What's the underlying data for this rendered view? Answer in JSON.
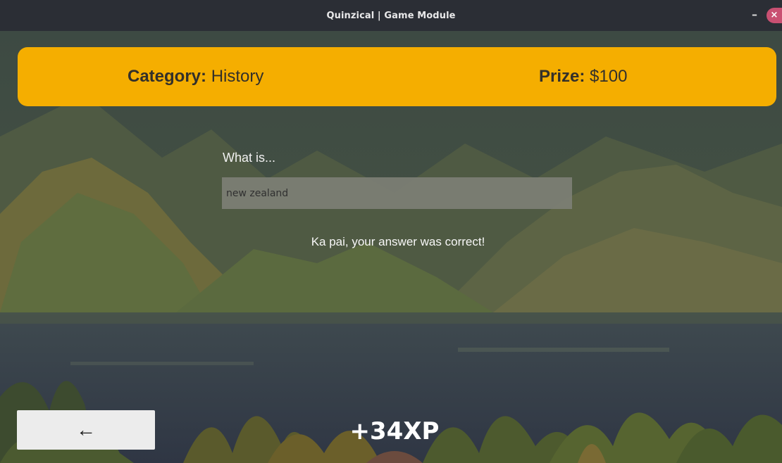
{
  "window": {
    "title": "Quinzical | Game Module",
    "minimize_label": "–",
    "close_label": "×"
  },
  "header": {
    "category_label": "Category:",
    "category_value": "History",
    "prize_label": "Prize:",
    "prize_value": "$100"
  },
  "question": {
    "prefix": "What is..."
  },
  "answer": {
    "value": "new zealand"
  },
  "feedback": {
    "message": "Ka pai, your answer was correct!"
  },
  "footer": {
    "back_icon": "left-arrow-icon",
    "back_label": "←",
    "xp": "+34XP"
  },
  "colors": {
    "banner": "#f5ae00",
    "title_bar": "#2b2e35",
    "close_button": "#c95072"
  }
}
